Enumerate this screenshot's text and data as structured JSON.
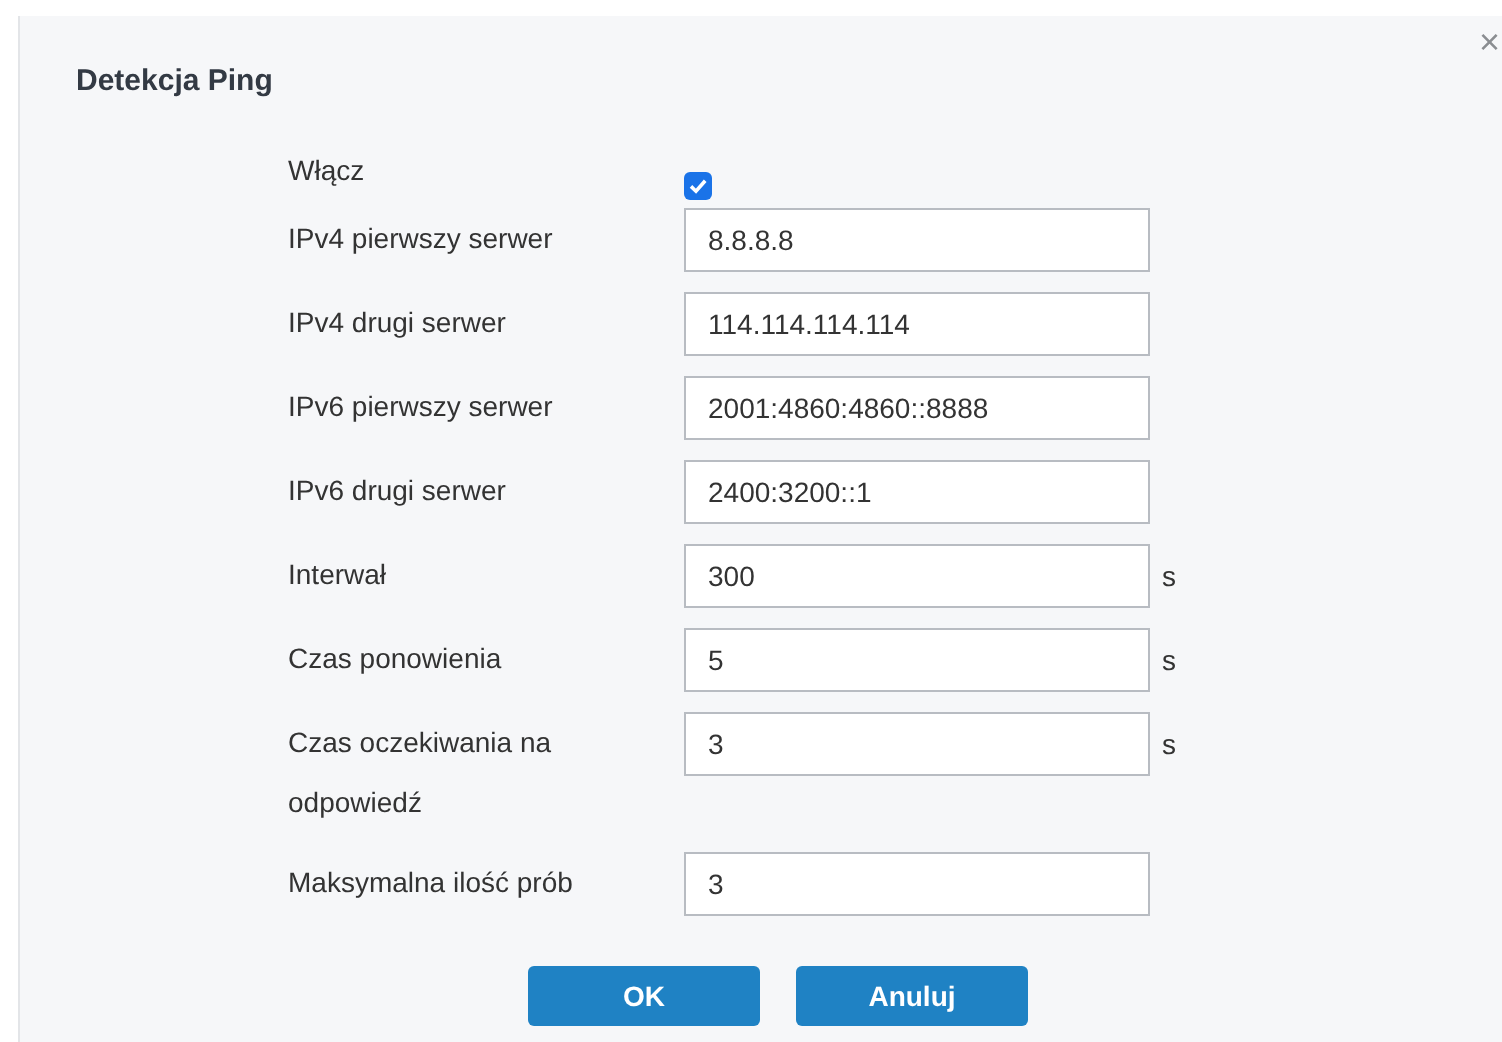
{
  "dialog": {
    "title": "Detekcja Ping",
    "close": "×"
  },
  "fields": [
    {
      "kind": "checkbox",
      "label": "Włącz",
      "checked": true
    },
    {
      "kind": "input",
      "label": "IPv4 pierwszy serwer",
      "value": "8.8.8.8"
    },
    {
      "kind": "input",
      "label": "IPv4 drugi serwer",
      "value": "114.114.114.114"
    },
    {
      "kind": "input",
      "label": "IPv6 pierwszy serwer",
      "value": "2001:4860:4860::8888"
    },
    {
      "kind": "input",
      "label": "IPv6 drugi serwer",
      "value": "2400:3200::1"
    },
    {
      "kind": "input",
      "label": "Interwał",
      "value": "300",
      "unit": "s"
    },
    {
      "kind": "input",
      "label": "Czas ponowienia",
      "value": "5",
      "unit": "s"
    },
    {
      "kind": "input",
      "label": "Czas oczekiwania na odpowiedź",
      "value": "3",
      "unit": "s"
    },
    {
      "kind": "input",
      "label": "Maksymalna ilość prób",
      "value": "3"
    }
  ],
  "buttons": [
    "OK",
    "Anuluj"
  ]
}
